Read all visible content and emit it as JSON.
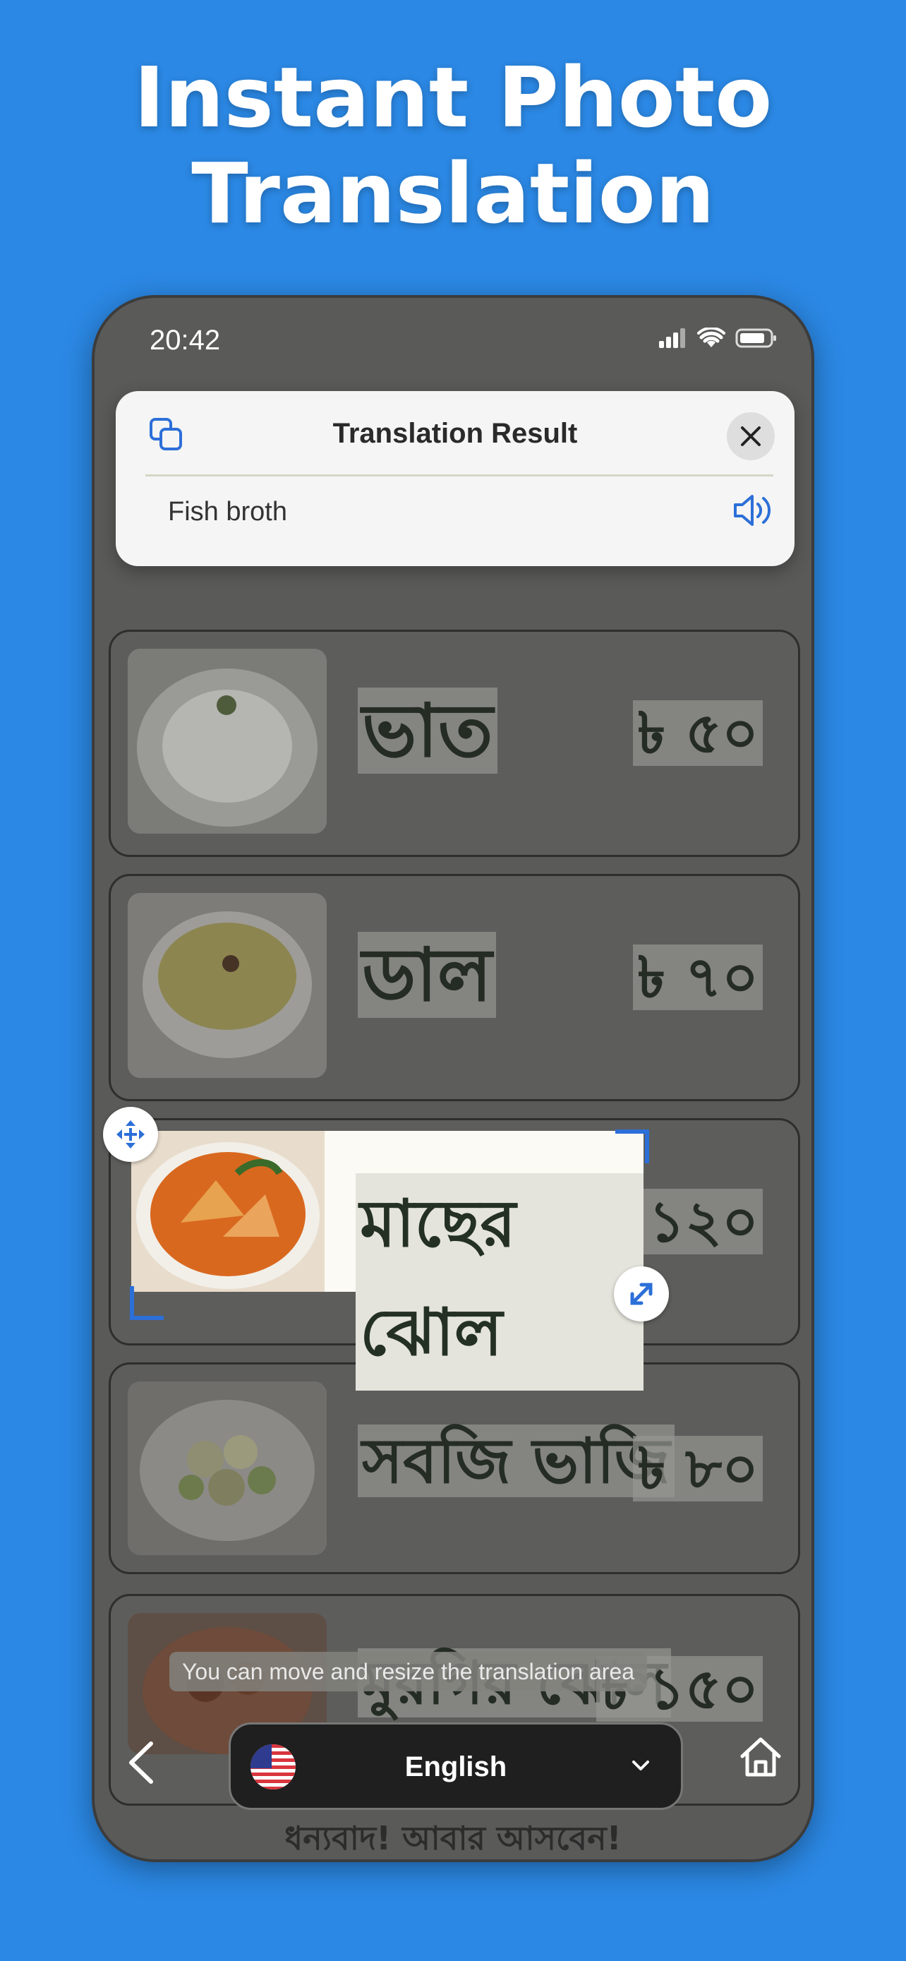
{
  "headline": {
    "line1": "Instant Photo",
    "line2": "Translation"
  },
  "status_bar": {
    "time": "20:42"
  },
  "translation_popup": {
    "title": "Translation Result",
    "result_text": "Fish broth"
  },
  "menu_items": [
    {
      "name": "ভাত",
      "price": "৳ ৫০",
      "image": "rice-bowl"
    },
    {
      "name": "ডাল",
      "price": "৳ ৭০",
      "image": "lentil-soup"
    },
    {
      "name": "মাছের ঝোল",
      "price": "৳ ১২০",
      "image": "fish-curry"
    },
    {
      "name": "সবজি ভাজি",
      "price": "৳ ৮০",
      "image": "vegetable-fry"
    },
    {
      "name": "মুরগির ঝোল",
      "price": "৳ ১৫০",
      "image": "chicken-curry"
    }
  ],
  "selection": {
    "text": "মাছের ঝোল"
  },
  "footer_text": "ধন্যবাদ! আবার আসবেন!",
  "hint": "You can move and resize the translation area",
  "language_selector": {
    "label": "English",
    "flag": "us-flag"
  },
  "colors": {
    "background": "#2b88e4",
    "accent": "#2c6fd8"
  }
}
